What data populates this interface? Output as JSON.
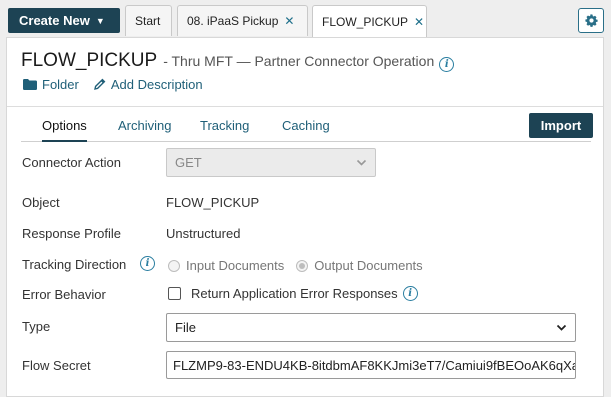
{
  "toolbar": {
    "create_new_label": "Create New",
    "tabs": [
      {
        "label": "Start"
      },
      {
        "label": "08. iPaaS Pickup"
      },
      {
        "label": "FLOW_PICKUP"
      }
    ],
    "settings_icon": "gear-icon"
  },
  "header": {
    "title": "FLOW_PICKUP",
    "subtitle": "- Thru MFT — Partner Connector Operation",
    "folder_label": "Folder",
    "add_description_label": "Add Description"
  },
  "subtabs": {
    "items": [
      {
        "label": "Options"
      },
      {
        "label": "Archiving"
      },
      {
        "label": "Tracking"
      },
      {
        "label": "Caching"
      }
    ],
    "active": "Options",
    "import_label": "Import"
  },
  "form": {
    "connector_action": {
      "label": "Connector Action",
      "value": "GET"
    },
    "object": {
      "label": "Object",
      "value": "FLOW_PICKUP"
    },
    "response_profile": {
      "label": "Response Profile",
      "value": "Unstructured"
    },
    "tracking_direction": {
      "label": "Tracking Direction",
      "option_input": "Input Documents",
      "option_output": "Output Documents",
      "selected": "Output Documents"
    },
    "error_behavior": {
      "label": "Error Behavior",
      "checkbox_label": "Return Application Error Responses",
      "checked": false
    },
    "type": {
      "label": "Type",
      "value": "File"
    },
    "flow_secret": {
      "label": "Flow Secret",
      "value": "FLZMP9-83-ENDU4KB-8itdbmAF8KKJmi3eT7/Camiui9fBEOoAK6qXa"
    }
  },
  "colors": {
    "primary_dark": "#1d4354",
    "link": "#1f5f78",
    "info": "#2a7ea0"
  }
}
